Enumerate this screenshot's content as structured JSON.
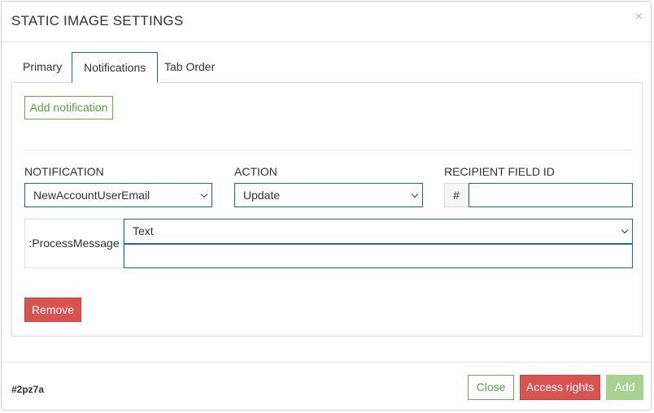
{
  "dialog": {
    "title": "STATIC IMAGE SETTINGS",
    "close_symbol": "×"
  },
  "tabs": [
    {
      "label": "Primary",
      "active": false
    },
    {
      "label": "Notifications",
      "active": true
    },
    {
      "label": "Tab Order",
      "active": false
    }
  ],
  "notifications_panel": {
    "add_notification_label": "Add notification",
    "notification_label": "NOTIFICATION",
    "notification_value": "NewAccountUserEmail",
    "action_label": "ACTION",
    "action_value": "Update",
    "recipient_label": "RECIPIENT FIELD ID",
    "recipient_prefix": "#",
    "recipient_value": "",
    "process_message_label": ":ProcessMessage",
    "message_type_value": "Text",
    "message_text_value": "",
    "remove_label": "Remove"
  },
  "footer": {
    "id_text": "#2pz7a",
    "close_label": "Close",
    "access_rights_label": "Access rights",
    "add_label": "Add"
  },
  "colors": {
    "accent_blue": "#1f6b8a",
    "success_green": "#5aa040",
    "danger_red": "#d9534f",
    "disabled_green": "#a6d18f"
  }
}
